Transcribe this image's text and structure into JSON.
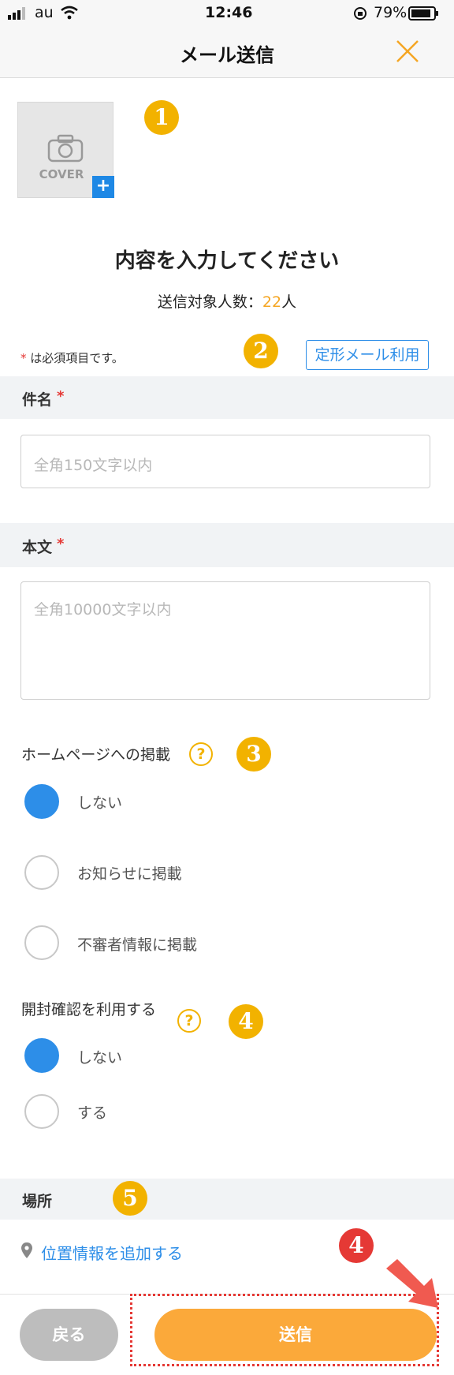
{
  "status_bar": {
    "carrier": "au",
    "time": "12:46",
    "battery": "79%"
  },
  "header": {
    "title": "メール送信"
  },
  "cover": {
    "label": "COVER",
    "add": "+"
  },
  "annotations": {
    "b1": "1",
    "b2": "2",
    "b3": "3",
    "b4": "4",
    "b5": "5",
    "b6": "4"
  },
  "heading": "内容を入力してください",
  "recipients": {
    "label": "送信対象人数：",
    "count": "22",
    "unit": "人"
  },
  "required_note": {
    "star": "*",
    "text": " は必須項目です。"
  },
  "template_button": "定形メール利用",
  "subject": {
    "label": "件名",
    "star": "*",
    "placeholder": "全角150文字以内"
  },
  "body": {
    "label": "本文",
    "star": "*",
    "placeholder": "全角10000文字以内"
  },
  "homepage": {
    "label": "ホームページへの掲載",
    "help": "?",
    "options": [
      "しない",
      "お知らせに掲載",
      "不審者情報に掲載"
    ],
    "selected": "しない"
  },
  "read_receipt": {
    "label": "開封確認を利用する",
    "help": "?",
    "options": [
      "しない",
      "する"
    ],
    "selected": "しない"
  },
  "location": {
    "label": "場所",
    "link": "位置情報を追加する"
  },
  "footer": {
    "back": "戻る",
    "send": "送信"
  },
  "colors": {
    "accent_orange": "#fba93a",
    "link_blue": "#2d8ee8",
    "annotation_yellow": "#f2b200",
    "annotation_red": "#e53935"
  }
}
